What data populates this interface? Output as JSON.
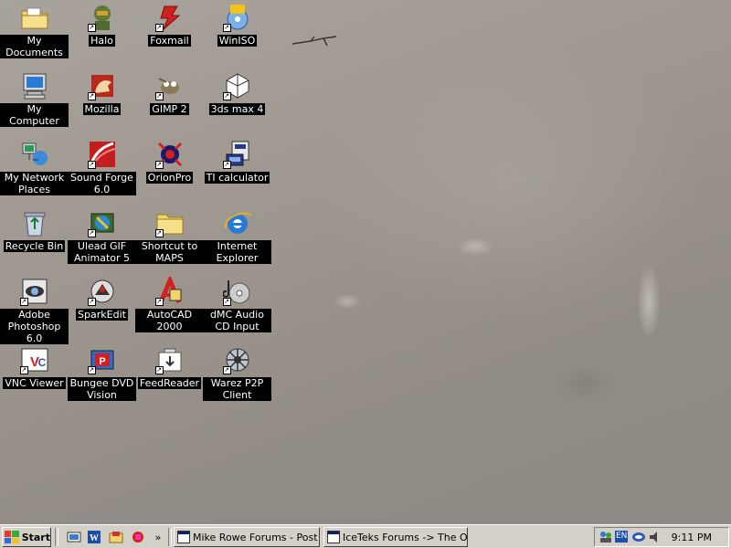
{
  "desktop": {
    "icons": [
      {
        "label": "My Documents",
        "icon": "folder-documents-icon"
      },
      {
        "label": "Halo",
        "icon": "halo-icon"
      },
      {
        "label": "Foxmail",
        "icon": "foxmail-icon"
      },
      {
        "label": "WinISO",
        "icon": "winiso-icon"
      },
      {
        "label": "My Computer",
        "icon": "computer-icon"
      },
      {
        "label": "Mozilla",
        "icon": "mozilla-icon"
      },
      {
        "label": "GIMP 2",
        "icon": "gimp-icon"
      },
      {
        "label": "3ds max 4",
        "icon": "3dsmax-icon"
      },
      {
        "label": "My Network Places",
        "icon": "network-icon"
      },
      {
        "label": "Sound Forge 6.0",
        "icon": "soundforge-icon"
      },
      {
        "label": "OrionPro",
        "icon": "orionpro-icon"
      },
      {
        "label": "TI calculator",
        "icon": "ti-calculator-icon"
      },
      {
        "label": "Recycle Bin",
        "icon": "recycle-bin-icon"
      },
      {
        "label": "Ulead GIF Animator 5",
        "icon": "ulead-icon"
      },
      {
        "label": "Shortcut to MAPS",
        "icon": "folder-icon"
      },
      {
        "label": "Internet Explorer",
        "icon": "ie-icon"
      },
      {
        "label": "Adobe Photoshop 6.0",
        "icon": "photoshop-icon"
      },
      {
        "label": "SparkEdit",
        "icon": "sparkedit-icon"
      },
      {
        "label": "AutoCAD 2000",
        "icon": "autocad-icon"
      },
      {
        "label": "dMC Audio CD Input",
        "icon": "cd-icon"
      },
      {
        "label": "VNC Viewer",
        "icon": "vnc-icon"
      },
      {
        "label": "Bungee DVD Vision",
        "icon": "bungee-icon"
      },
      {
        "label": "FeedReader",
        "icon": "feedreader-icon"
      },
      {
        "label": "Warez P2P Client",
        "icon": "warez-icon"
      }
    ]
  },
  "taskbar": {
    "start_label": "Start",
    "quick_launch": [
      "desktop-icon",
      "word-icon",
      "explorer-icon",
      "app-icon"
    ],
    "quick_launch_more": "»",
    "tasks": [
      {
        "label": "Mike Rowe Forums - Post ...",
        "icon": "browser-window-icon"
      },
      {
        "label": "IceTeks Forums -> The O...",
        "icon": "browser-window-icon"
      }
    ],
    "tray": {
      "language": "EN",
      "clock": "9:11 PM"
    }
  },
  "colors": {
    "taskbar": "#d4d0c8",
    "label_bg": "#000000",
    "label_fg": "#ffffff"
  }
}
